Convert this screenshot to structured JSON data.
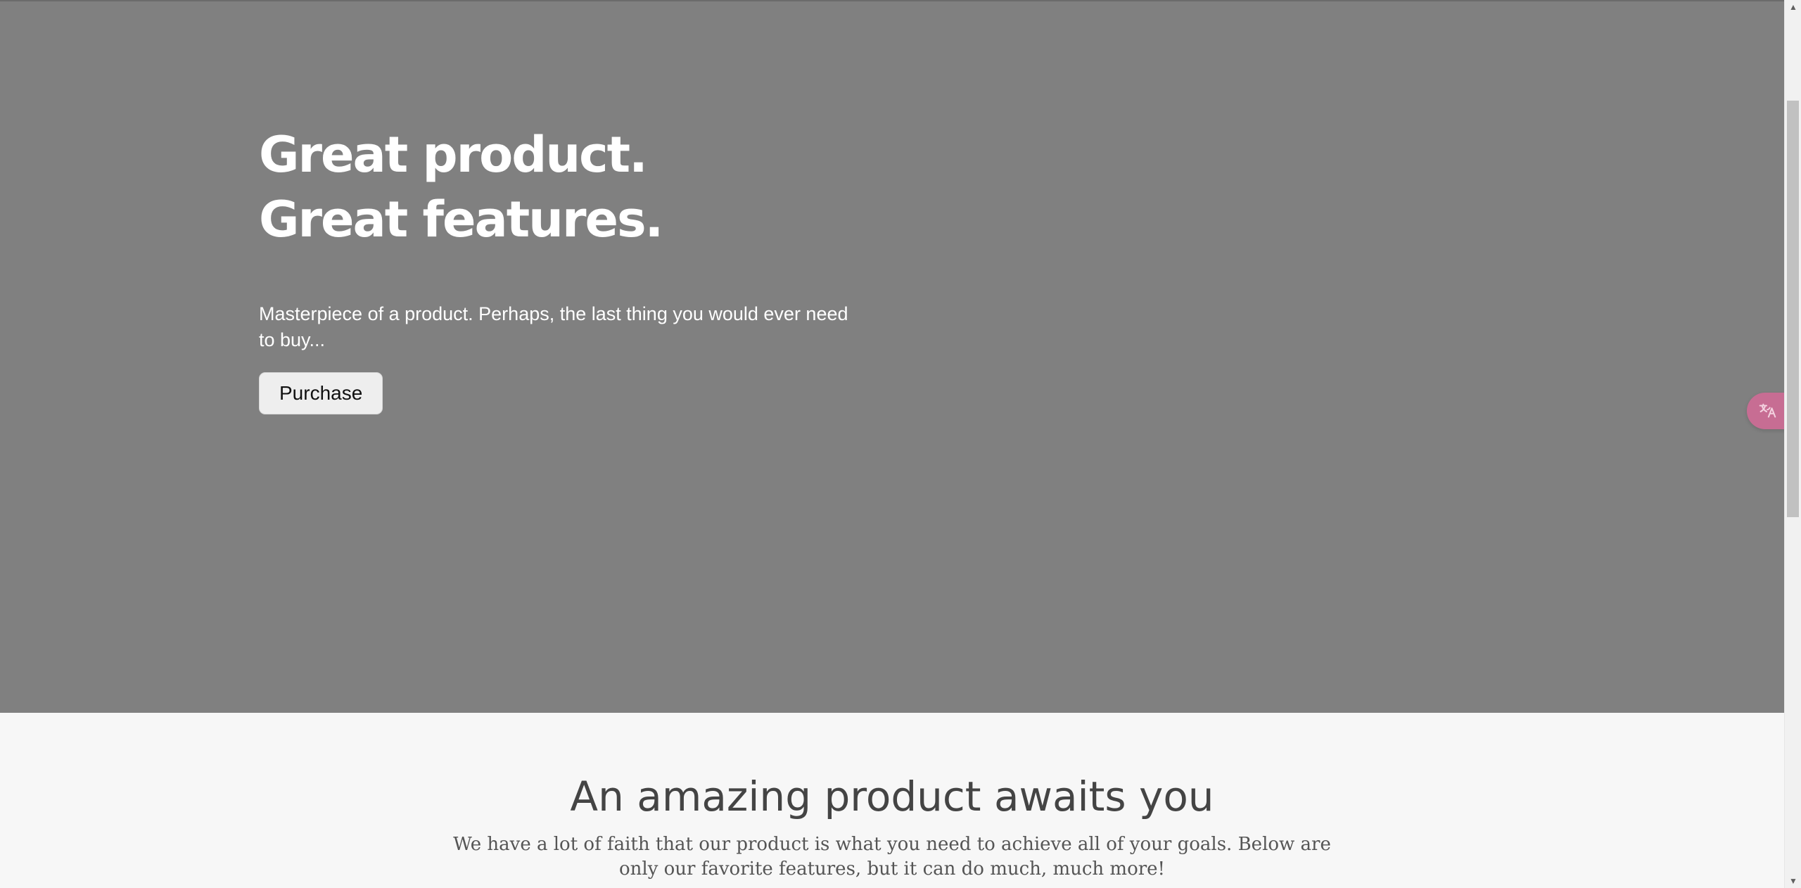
{
  "hero": {
    "title_line_1": "Great product.",
    "title_line_2": "Great features.",
    "subtitle": "Masterpiece of a product. Perhaps, the last thing you would ever need to buy...",
    "purchase_label": "Purchase",
    "background_color": "#808080"
  },
  "features": {
    "title": "An amazing product awaits you",
    "description": "We have a lot of faith that our product is what you need to achieve all of your goals. Below are only our favorite features, but it can do much, much more!",
    "background_color": "#f7f7f7"
  },
  "translate_button": {
    "icon": "translate-icon",
    "accent_color": "#c76d93"
  },
  "scrollbar": {
    "up_arrow": "▲",
    "down_arrow": "▼"
  }
}
